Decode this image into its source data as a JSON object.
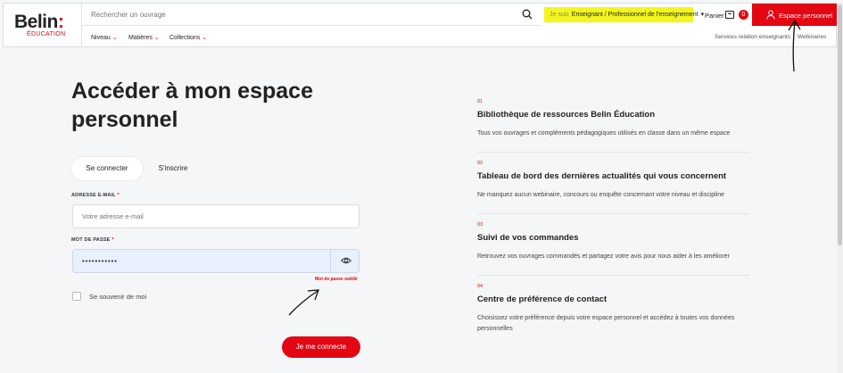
{
  "logo": {
    "main": "Belin",
    "colon": ":",
    "sub": "ÉDUCATION"
  },
  "search": {
    "placeholder": "Rechercher un ouvrage"
  },
  "profile": {
    "prefix": "Je suis",
    "value": "Enseignant / Professionnel de l'enseignement"
  },
  "cart": {
    "label": "Panier",
    "count": "0"
  },
  "account": {
    "label": "Espace personnel"
  },
  "nav": {
    "items": [
      {
        "label": "Niveau"
      },
      {
        "label": "Matières"
      },
      {
        "label": "Collections"
      }
    ],
    "right": [
      {
        "label": "Services relation enseignants"
      },
      {
        "label": "Webinaires"
      }
    ]
  },
  "page": {
    "title": "Accéder à mon espace personnel"
  },
  "tabs": {
    "login": "Se connecter",
    "signup": "S'inscrire"
  },
  "form": {
    "email_label": "ADRESSE E-MAIL",
    "email_placeholder": "Votre adresse e-mail",
    "password_label": "MOT DE PASSE",
    "password_value": "•••••••••••",
    "required_mark": "*",
    "forgot": "Mot de passe oublié",
    "remember": "Se souvenir de moi",
    "submit": "Je me connecte"
  },
  "features": [
    {
      "num": "01",
      "title": "Bibliothèque de ressources Belin Éducation",
      "desc": "Tous vos ouvrages et compléments pédagogiques utilisés en classe dans un même espace"
    },
    {
      "num": "02",
      "title": "Tableau de bord des dernières actualités qui vous concernent",
      "desc": "Ne manquez aucun webinaire, concours ou enquête concernant votre niveau et discipline"
    },
    {
      "num": "03",
      "title": "Suivi de vos commandes",
      "desc": "Retrouvez vos ouvrages commandés et partagez votre avis pour nous aider à les améliorer"
    },
    {
      "num": "04",
      "title": "Centre de préférence de contact",
      "desc": "Choisissez votre préférence depuis votre espace personnel et accédez à toutes vos données personnelles"
    }
  ],
  "colors": {
    "accent": "#e30613",
    "highlight": "#f3f51f"
  }
}
